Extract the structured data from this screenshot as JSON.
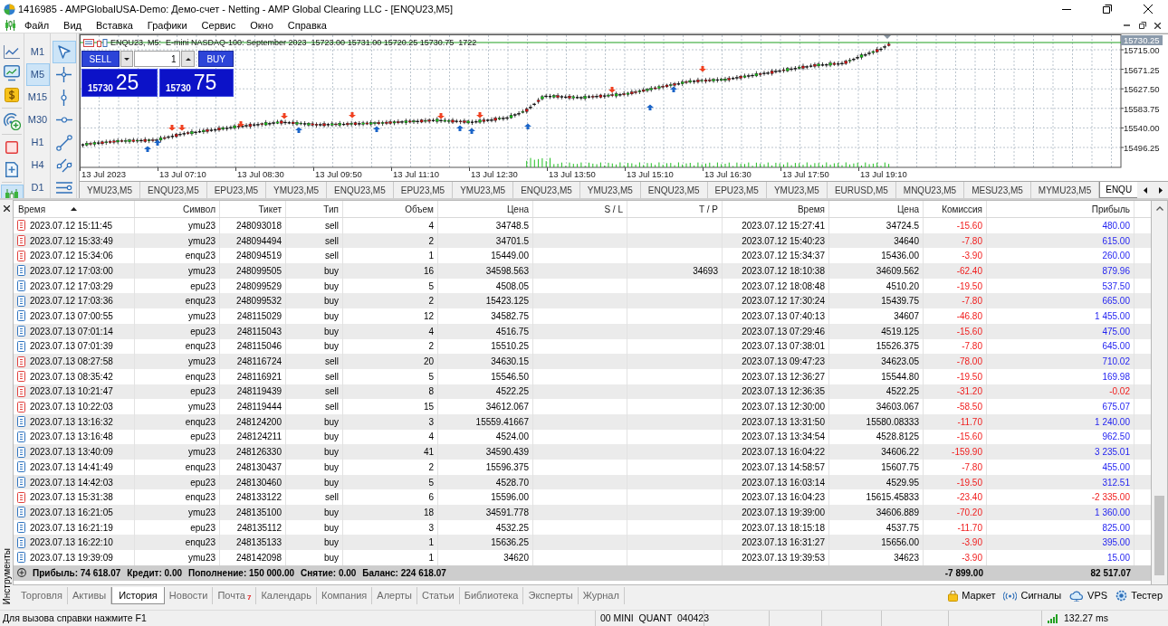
{
  "window": {
    "title": "1416985 - AMPGlobalUSA-Demo: Демо-счет - Netting - AMP Global Clearing LLC - [ENQU23,M5]"
  },
  "menu": [
    "Файл",
    "Вид",
    "Вставка",
    "Графики",
    "Сервис",
    "Окно",
    "Справка"
  ],
  "left_toolbar": [
    {
      "selected": false
    },
    {
      "selected": false
    },
    {
      "selected": false
    },
    {
      "selected": false
    },
    {
      "selected": false
    },
    {
      "selected": false
    },
    {
      "selected": true
    }
  ],
  "timeframes": [
    {
      "label": "M1",
      "selected": false
    },
    {
      "label": "M5",
      "selected": true
    },
    {
      "label": "M15",
      "selected": false
    },
    {
      "label": "M30",
      "selected": false
    },
    {
      "label": "H1",
      "selected": false
    },
    {
      "label": "H4",
      "selected": false
    },
    {
      "label": "D1",
      "selected": false
    }
  ],
  "drawing_tools": [
    {
      "selected": true
    },
    {
      "selected": false
    },
    {
      "selected": false
    },
    {
      "selected": false
    },
    {
      "selected": false
    },
    {
      "selected": false
    },
    {
      "selected": false
    }
  ],
  "chart": {
    "header": "ENQU23, M5:  E-mini NASDAQ-100: September 2023  15723.00 15731.00 15720.25 15730.75  1722",
    "one_click": {
      "sell": "SELL",
      "buy": "BUY",
      "volume": "1",
      "sell_price": "15730",
      "sell_pips": "25",
      "buy_price": "15730",
      "buy_pips": "75"
    },
    "current_price": "15730.25",
    "price_labels": [
      "15715.00",
      "15671.25",
      "15627.50",
      "15583.75",
      "15540.00",
      "15496.25"
    ],
    "time_labels": [
      "13 Jul 2023",
      "13 Jul 07:10",
      "13 Jul 08:30",
      "13 Jul 09:50",
      "13 Jul 11:10",
      "13 Jul 12:30",
      "13 Jul 13:50",
      "13 Jul 15:10",
      "13 Jul 16:30",
      "13 Jul 17:50",
      "13 Jul 19:10"
    ]
  },
  "chart_tabs": [
    {
      "label": "YMU23,M5",
      "selected": false
    },
    {
      "label": "ENQU23,M5",
      "selected": false
    },
    {
      "label": "EPU23,M5",
      "selected": false
    },
    {
      "label": "YMU23,M5",
      "selected": false
    },
    {
      "label": "ENQU23,M5",
      "selected": false
    },
    {
      "label": "EPU23,M5",
      "selected": false
    },
    {
      "label": "YMU23,M5",
      "selected": false
    },
    {
      "label": "ENQU23,M5",
      "selected": false
    },
    {
      "label": "YMU23,M5",
      "selected": false
    },
    {
      "label": "ENQU23,M5",
      "selected": false
    },
    {
      "label": "EPU23,M5",
      "selected": false
    },
    {
      "label": "YMU23,M5",
      "selected": false
    },
    {
      "label": "EURUSD,M5",
      "selected": false
    },
    {
      "label": "MNQU23,M5",
      "selected": false
    },
    {
      "label": "MESU23,M5",
      "selected": false
    },
    {
      "label": "MYMU23,M5",
      "selected": false
    },
    {
      "label": "ENQU",
      "selected": true
    }
  ],
  "toolbox": {
    "title": "Инструменты",
    "table": {
      "columns": [
        {
          "label": "Время",
          "sorted": true
        },
        {
          "label": "Символ"
        },
        {
          "label": "Тикет"
        },
        {
          "label": "Тип"
        },
        {
          "label": "Объем"
        },
        {
          "label": "Цена"
        },
        {
          "label": "S / L"
        },
        {
          "label": "T / P"
        },
        {
          "label": "Время"
        },
        {
          "label": "Цена"
        },
        {
          "label": "Комиссия"
        },
        {
          "label": "Прибыль"
        }
      ],
      "rows": [
        {
          "kind": "sell",
          "time": "2023.07.12 15:11:45",
          "symbol": "ymu23",
          "ticket": "248093018",
          "type": "sell",
          "volume": "4",
          "price": "34748.5",
          "close_time": "2023.07.12 15:27:41",
          "close_price": "34724.5",
          "commission": "-15.60",
          "profit": "480.00",
          "loss": false
        },
        {
          "kind": "sell",
          "time": "2023.07.12 15:33:49",
          "symbol": "ymu23",
          "ticket": "248094494",
          "type": "sell",
          "volume": "2",
          "price": "34701.5",
          "close_time": "2023.07.12 15:40:23",
          "close_price": "34640",
          "commission": "-7.80",
          "profit": "615.00",
          "loss": false
        },
        {
          "kind": "sell",
          "time": "2023.07.12 15:34:06",
          "symbol": "enqu23",
          "ticket": "248094519",
          "type": "sell",
          "volume": "1",
          "price": "15449.00",
          "close_time": "2023.07.12 15:34:37",
          "close_price": "15436.00",
          "commission": "-3.90",
          "profit": "260.00",
          "loss": false
        },
        {
          "kind": "buy",
          "time": "2023.07.12 17:03:00",
          "symbol": "ymu23",
          "ticket": "248099505",
          "type": "buy",
          "volume": "16",
          "price": "34598.563",
          "tp": "34693",
          "close_time": "2023.07.12 18:10:38",
          "close_price": "34609.562",
          "commission": "-62.40",
          "profit": "879.96",
          "loss": false
        },
        {
          "kind": "buy",
          "time": "2023.07.12 17:03:29",
          "symbol": "epu23",
          "ticket": "248099529",
          "type": "buy",
          "volume": "5",
          "price": "4508.05",
          "close_time": "2023.07.12 18:08:48",
          "close_price": "4510.20",
          "commission": "-19.50",
          "profit": "537.50",
          "loss": false
        },
        {
          "kind": "buy",
          "time": "2023.07.12 17:03:36",
          "symbol": "enqu23",
          "ticket": "248099532",
          "type": "buy",
          "volume": "2",
          "price": "15423.125",
          "close_time": "2023.07.12 17:30:24",
          "close_price": "15439.75",
          "commission": "-7.80",
          "profit": "665.00",
          "loss": false
        },
        {
          "kind": "buy",
          "time": "2023.07.13 07:00:55",
          "symbol": "ymu23",
          "ticket": "248115029",
          "type": "buy",
          "volume": "12",
          "price": "34582.75",
          "close_time": "2023.07.13 07:40:13",
          "close_price": "34607",
          "commission": "-46.80",
          "profit": "1 455.00",
          "loss": false
        },
        {
          "kind": "buy",
          "time": "2023.07.13 07:01:14",
          "symbol": "epu23",
          "ticket": "248115043",
          "type": "buy",
          "volume": "4",
          "price": "4516.75",
          "close_time": "2023.07.13 07:29:46",
          "close_price": "4519.125",
          "commission": "-15.60",
          "profit": "475.00",
          "loss": false
        },
        {
          "kind": "buy",
          "time": "2023.07.13 07:01:39",
          "symbol": "enqu23",
          "ticket": "248115046",
          "type": "buy",
          "volume": "2",
          "price": "15510.25",
          "close_time": "2023.07.13 07:38:01",
          "close_price": "15526.375",
          "commission": "-7.80",
          "profit": "645.00",
          "loss": false
        },
        {
          "kind": "sell",
          "time": "2023.07.13 08:27:58",
          "symbol": "ymu23",
          "ticket": "248116724",
          "type": "sell",
          "volume": "20",
          "price": "34630.15",
          "close_time": "2023.07.13 09:47:23",
          "close_price": "34623.05",
          "commission": "-78.00",
          "profit": "710.02",
          "loss": false
        },
        {
          "kind": "sell",
          "time": "2023.07.13 08:35:42",
          "symbol": "enqu23",
          "ticket": "248116921",
          "type": "sell",
          "volume": "5",
          "price": "15546.50",
          "close_time": "2023.07.13 12:36:27",
          "close_price": "15544.80",
          "commission": "-19.50",
          "profit": "169.98",
          "loss": false
        },
        {
          "kind": "sell",
          "time": "2023.07.13 10:21:47",
          "symbol": "epu23",
          "ticket": "248119439",
          "type": "sell",
          "volume": "8",
          "price": "4522.25",
          "close_time": "2023.07.13 12:36:35",
          "close_price": "4522.25",
          "commission": "-31.20",
          "profit": "-0.02",
          "loss": true
        },
        {
          "kind": "sell",
          "time": "2023.07.13 10:22:03",
          "symbol": "ymu23",
          "ticket": "248119444",
          "type": "sell",
          "volume": "15",
          "price": "34612.067",
          "close_time": "2023.07.13 12:30:00",
          "close_price": "34603.067",
          "commission": "-58.50",
          "profit": "675.07",
          "loss": false
        },
        {
          "kind": "buy",
          "time": "2023.07.13 13:16:32",
          "symbol": "enqu23",
          "ticket": "248124200",
          "type": "buy",
          "volume": "3",
          "price": "15559.41667",
          "close_time": "2023.07.13 13:31:50",
          "close_price": "15580.08333",
          "commission": "-11.70",
          "profit": "1 240.00",
          "loss": false
        },
        {
          "kind": "buy",
          "time": "2023.07.13 13:16:48",
          "symbol": "epu23",
          "ticket": "248124211",
          "type": "buy",
          "volume": "4",
          "price": "4524.00",
          "close_time": "2023.07.13 13:34:54",
          "close_price": "4528.8125",
          "commission": "-15.60",
          "profit": "962.50",
          "loss": false
        },
        {
          "kind": "buy",
          "time": "2023.07.13 13:40:09",
          "symbol": "ymu23",
          "ticket": "248126330",
          "type": "buy",
          "volume": "41",
          "price": "34590.439",
          "close_time": "2023.07.13 16:04:22",
          "close_price": "34606.22",
          "commission": "-159.90",
          "profit": "3 235.01",
          "loss": false
        },
        {
          "kind": "buy",
          "time": "2023.07.13 14:41:49",
          "symbol": "enqu23",
          "ticket": "248130437",
          "type": "buy",
          "volume": "2",
          "price": "15596.375",
          "close_time": "2023.07.13 14:58:57",
          "close_price": "15607.75",
          "commission": "-7.80",
          "profit": "455.00",
          "loss": false
        },
        {
          "kind": "buy",
          "time": "2023.07.13 14:42:03",
          "symbol": "epu23",
          "ticket": "248130460",
          "type": "buy",
          "volume": "5",
          "price": "4528.70",
          "close_time": "2023.07.13 16:03:14",
          "close_price": "4529.95",
          "commission": "-19.50",
          "profit": "312.51",
          "loss": false
        },
        {
          "kind": "sell",
          "time": "2023.07.13 15:31:38",
          "symbol": "enqu23",
          "ticket": "248133122",
          "type": "sell",
          "volume": "6",
          "price": "15596.00",
          "close_time": "2023.07.13 16:04:23",
          "close_price": "15615.45833",
          "commission": "-23.40",
          "profit": "-2 335.00",
          "loss": true
        },
        {
          "kind": "buy",
          "time": "2023.07.13 16:21:05",
          "symbol": "ymu23",
          "ticket": "248135100",
          "type": "buy",
          "volume": "18",
          "price": "34591.778",
          "close_time": "2023.07.13 19:39:00",
          "close_price": "34606.889",
          "commission": "-70.20",
          "profit": "1 360.00",
          "loss": false
        },
        {
          "kind": "buy",
          "time": "2023.07.13 16:21:19",
          "symbol": "epu23",
          "ticket": "248135112",
          "type": "buy",
          "volume": "3",
          "price": "4532.25",
          "close_time": "2023.07.13 18:15:18",
          "close_price": "4537.75",
          "commission": "-11.70",
          "profit": "825.00",
          "loss": false
        },
        {
          "kind": "buy",
          "time": "2023.07.13 16:22:10",
          "symbol": "enqu23",
          "ticket": "248135133",
          "type": "buy",
          "volume": "1",
          "price": "15636.25",
          "close_time": "2023.07.13 16:31:27",
          "close_price": "15656.00",
          "commission": "-3.90",
          "profit": "395.00",
          "loss": false
        },
        {
          "kind": "buy",
          "time": "2023.07.13 19:39:09",
          "symbol": "ymu23",
          "ticket": "248142098",
          "type": "buy",
          "volume": "1",
          "price": "34620",
          "close_time": "2023.07.13 19:39:53",
          "close_price": "34623",
          "commission": "-3.90",
          "profit": "15.00",
          "loss": false
        }
      ],
      "summary": {
        "items": [
          "Прибыль: 74 618.07",
          "Кредит: 0.00",
          "Пополнение: 150 000.00",
          "Снятие: 0.00",
          "Баланс: 224 618.07"
        ],
        "commission": "-7 899.00",
        "profit": "82 517.07"
      }
    },
    "tabs": [
      {
        "label": "Торговля",
        "selected": false
      },
      {
        "label": "Активы",
        "selected": false
      },
      {
        "label": "История",
        "selected": true
      },
      {
        "label": "Новости",
        "selected": false
      },
      {
        "label": "Почта",
        "count": "7",
        "selected": false
      },
      {
        "label": "Календарь",
        "selected": false
      },
      {
        "label": "Компания",
        "selected": false
      },
      {
        "label": "Алерты",
        "selected": false
      },
      {
        "label": "Статьи",
        "selected": false
      },
      {
        "label": "Библиотека",
        "selected": false
      },
      {
        "label": "Эксперты",
        "selected": false
      },
      {
        "label": "Журнал",
        "selected": false
      }
    ],
    "links": [
      "Маркет",
      "Сигналы",
      "VPS",
      "Тестер"
    ]
  },
  "status_bar": {
    "help": "Для вызова справки нажмите F1",
    "profile": "00 MINI  QUANT  040423",
    "ping": "132.27 ms"
  }
}
